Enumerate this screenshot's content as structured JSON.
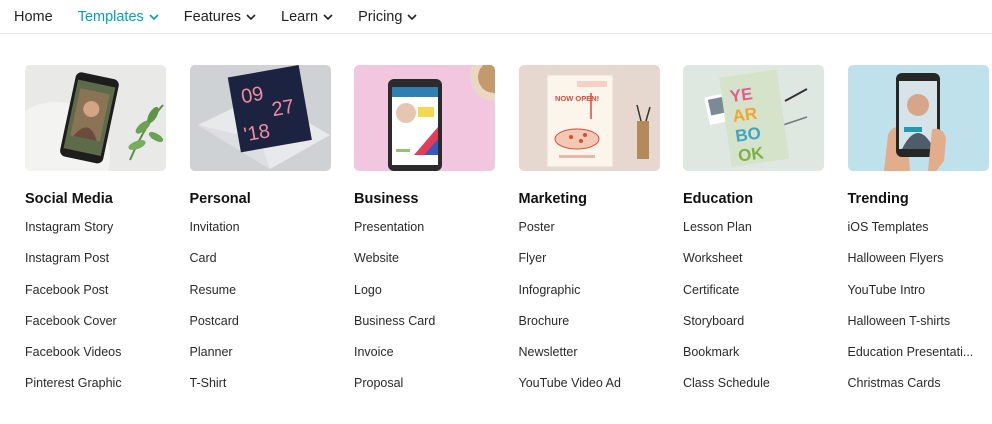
{
  "nav": {
    "items": [
      {
        "label": "Home",
        "has_dropdown": false,
        "active": false
      },
      {
        "label": "Templates",
        "has_dropdown": true,
        "active": true
      },
      {
        "label": "Features",
        "has_dropdown": true,
        "active": false
      },
      {
        "label": "Learn",
        "has_dropdown": true,
        "active": false
      },
      {
        "label": "Pricing",
        "has_dropdown": true,
        "active": false
      }
    ],
    "active_color": "#00a3b4"
  },
  "thumb_texts": {
    "personal_date": [
      "09",
      "27",
      "'18"
    ],
    "marketing_poster": "NOW OPEN!",
    "education_yearbook": [
      "YE",
      "AR",
      "BO",
      "OK"
    ]
  },
  "columns": [
    {
      "heading": "Social Media",
      "thumb_icon": "phone-story-icon",
      "links": [
        "Instagram Story",
        "Instagram Post",
        "Facebook Post",
        "Facebook Cover",
        "Facebook Videos",
        "Pinterest Graphic"
      ]
    },
    {
      "heading": "Personal",
      "thumb_icon": "invitation-card-icon",
      "links": [
        "Invitation",
        "Card",
        "Resume",
        "Postcard",
        "Planner",
        "T-Shirt"
      ]
    },
    {
      "heading": "Business",
      "thumb_icon": "phone-app-icon",
      "links": [
        "Presentation",
        "Website",
        "Logo",
        "Business Card",
        "Invoice",
        "Proposal"
      ]
    },
    {
      "heading": "Marketing",
      "thumb_icon": "poster-icon",
      "links": [
        "Poster",
        "Flyer",
        "Infographic",
        "Brochure",
        "Newsletter",
        "YouTube Video Ad"
      ]
    },
    {
      "heading": "Education",
      "thumb_icon": "yearbook-icon",
      "links": [
        "Lesson Plan",
        "Worksheet",
        "Certificate",
        "Storyboard",
        "Bookmark",
        "Class Schedule"
      ]
    },
    {
      "heading": "Trending",
      "thumb_icon": "hand-phone-icon",
      "links": [
        "iOS Templates",
        "Halloween Flyers",
        "YouTube Intro",
        "Halloween T-shirts",
        "Education Presentati...",
        "Christmas Cards"
      ]
    }
  ]
}
